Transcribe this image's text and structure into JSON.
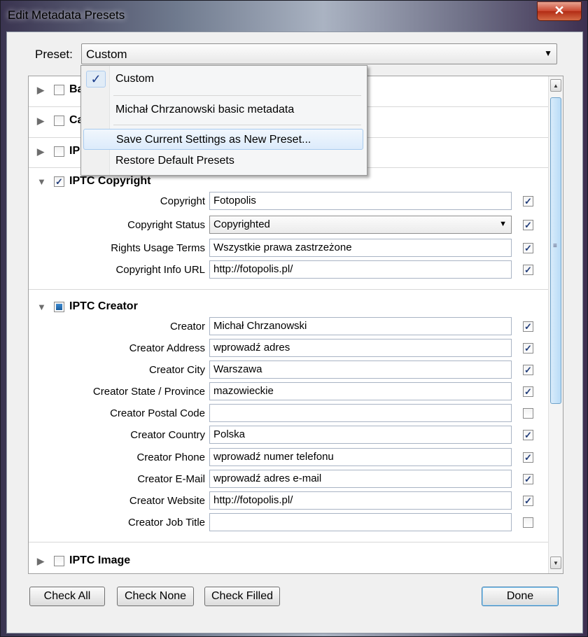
{
  "window": {
    "title": "Edit Metadata Presets",
    "close_glyph": "✕"
  },
  "preset": {
    "label": "Preset:",
    "value": "Custom"
  },
  "dropdown": {
    "items": [
      {
        "label": "Custom",
        "checked": true
      },
      {
        "label": "Michał Chrzanowski basic metadata"
      },
      {
        "label": "Save Current Settings as New Preset..."
      },
      {
        "label": "Restore Default Presets"
      }
    ],
    "check_glyph": "✓"
  },
  "sections": {
    "basic": {
      "name": "Basic Info",
      "visible_name": "Ba",
      "checked": false,
      "expanded": false
    },
    "camera": {
      "name": "Camera Info",
      "visible_name": "Ca",
      "checked": false,
      "expanded": false
    },
    "iptc_content": {
      "name": "IPTC Content",
      "visible_name": "IP",
      "checked": false,
      "expanded": false
    },
    "iptc_copyright": {
      "name": "IPTC Copyright",
      "checked": true,
      "expanded": true,
      "fields": [
        {
          "label": "Copyright",
          "value": "Fotopolis",
          "checked": true
        },
        {
          "label": "Copyright Status",
          "value": "Copyrighted",
          "checked": true,
          "type": "select"
        },
        {
          "label": "Rights Usage Terms",
          "value": "Wszystkie prawa zastrzeżone",
          "checked": true
        },
        {
          "label": "Copyright Info URL",
          "value": "http://fotopolis.pl/",
          "checked": true
        }
      ]
    },
    "iptc_creator": {
      "name": "IPTC Creator",
      "checked": "partial",
      "expanded": true,
      "fields": [
        {
          "label": "Creator",
          "value": "Michał Chrzanowski",
          "checked": true
        },
        {
          "label": "Creator Address",
          "value": "wprowadź adres",
          "checked": true
        },
        {
          "label": "Creator City",
          "value": "Warszawa",
          "checked": true
        },
        {
          "label": "Creator State / Province",
          "value": "mazowieckie",
          "checked": true
        },
        {
          "label": "Creator Postal Code",
          "value": "",
          "checked": false
        },
        {
          "label": "Creator Country",
          "value": "Polska",
          "checked": true
        },
        {
          "label": "Creator Phone",
          "value": "wprowadź numer telefonu",
          "checked": true
        },
        {
          "label": "Creator E-Mail",
          "value": "wprowadź adres e-mail",
          "checked": true
        },
        {
          "label": "Creator Website",
          "value": "http://fotopolis.pl/",
          "checked": true
        },
        {
          "label": "Creator Job Title",
          "value": "",
          "checked": false
        }
      ]
    },
    "iptc_image": {
      "name": "IPTC Image",
      "checked": false,
      "expanded": false
    }
  },
  "buttons": {
    "check_all": "Check All",
    "check_none": "Check None",
    "check_filled": "Check Filled",
    "done": "Done"
  },
  "glyphs": {
    "collapsed": "▶",
    "expanded": "▼",
    "check": "✓",
    "select_arrow": "▼",
    "scroll_up": "▲",
    "scroll_down": "▼",
    "scroll_grip": "≡"
  }
}
